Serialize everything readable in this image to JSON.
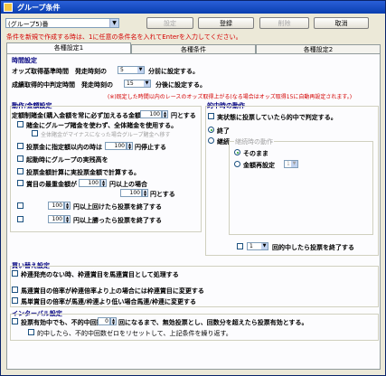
{
  "window": {
    "title": "グループ条件"
  },
  "toolbar": {
    "group_select": "(グループ5)番",
    "setting_label": "設定",
    "register_label": "登録",
    "delete_label": "削除",
    "cancel_label": "取消"
  },
  "notice": "条件を新規で作成する時は、1に任意の条件名を入れてEnterを入力してください。",
  "tabs": [
    "各種設定1",
    "各種条件",
    "各種設定2"
  ],
  "timing": {
    "heading": "時間設定",
    "odds_label": "オッズ取得基準時間　発走時刻の",
    "odds_value": "5",
    "odds_unit": "分前に設定する。",
    "result_label": "成績取得的中判定時間　発走時刻の",
    "result_value": "15",
    "result_unit": "分後に設定する。",
    "warning": "(※)既定した時間以内のレースのオッズ取得上がる(なる場合はオッズ取得15に自動再設定されます。)"
  },
  "money": {
    "heading": "動作/金額設定",
    "fixed_label": "定額制賭金(購入金額を常に必ず加えるる金額)",
    "fixed_value": "100",
    "fixed_unit": "円とする",
    "group_funds_label": "賭金にグループ賭金を使わず、全体賭金を使用する。",
    "group_funds_sub": "全体賭金がマイナスになった場合グループ賭金へ移す",
    "stop_label": "投票金に指定額以内の時は",
    "stop_value": "100",
    "stop_unit": "円停止する",
    "startup_label": "起動時にグループの実残高を",
    "calc_label": "投票金額計算に実投票金額で計算する。",
    "min_label": "賞目の最重金額が",
    "min_value": "100",
    "min_unit": "円以上の場合",
    "min_value2": "100",
    "min_unit2": "円とする",
    "stop_over_value": "100",
    "stop_over_label": "円以上回けたら投票を終了する",
    "stop_over_value2": "100",
    "stop_over_label2": "円以上勝ったら投票を終了する"
  },
  "hit": {
    "heading": "的中時の動作",
    "judge_label": "実状態に投票していたら的中で判定する。",
    "end_label": "終了",
    "cont_label": "継続",
    "cont_group": "継続時の動作",
    "keep_label": "そのまま",
    "reset_label": "金額再設定",
    "reset_value": "1",
    "rounds_value": "1",
    "rounds_label": "回的中したら投票を終了する"
  },
  "buy": {
    "heading": "買い替え設定",
    "opt1": "枠連発売のない時、枠連賞目を馬連賞目として処理する",
    "opt2": "馬連賞目の倍率が枠連倍率より上の場合には枠連賞目に変更する",
    "opt3": "馬単賞目の倍率が馬連/枠連より低い場合馬連/枠連に変更する"
  },
  "interval": {
    "heading": "インターバル設定",
    "label_a": "投票有効中でも、不的中回数",
    "value": "0",
    "label_b": "回になるまで、無効投票とし、回数分を超えたら投票有効とする。",
    "sub": "的中したら、不的中回数ゼロをリセットして、上記条件を繰り返す。"
  }
}
